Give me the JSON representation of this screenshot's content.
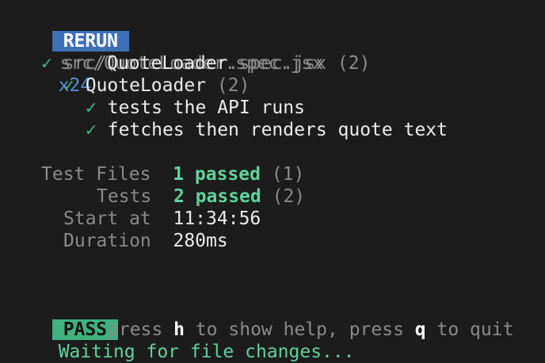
{
  "header": {
    "badge": "RERUN",
    "file": "src/QuoteLoader.spec.jsx",
    "count": "x24"
  },
  "results": {
    "check": "✓",
    "file_dir": "src/",
    "file_name": "QuoteLoader",
    "file_ext": ".spec.jsx",
    "file_count": "(2)",
    "suite_name": "QuoteLoader",
    "suite_count": "(2)",
    "tests": [
      "tests the API runs",
      "fetches then renders quote text"
    ]
  },
  "summary": {
    "test_files_label": "Test Files",
    "test_files_value": "1 passed",
    "test_files_total": "(1)",
    "tests_label": "Tests",
    "tests_value": "2 passed",
    "tests_total": "(2)",
    "start_label": "Start at",
    "start_value": "11:34:56",
    "duration_label": "Duration",
    "duration_value": "280ms"
  },
  "footer": {
    "badge": "PASS",
    "status": "Waiting for file changes...",
    "help_press1": "press",
    "help_key1": "h",
    "help_text1": "to show help, press",
    "help_key2": "q",
    "help_text2": "to quit"
  }
}
